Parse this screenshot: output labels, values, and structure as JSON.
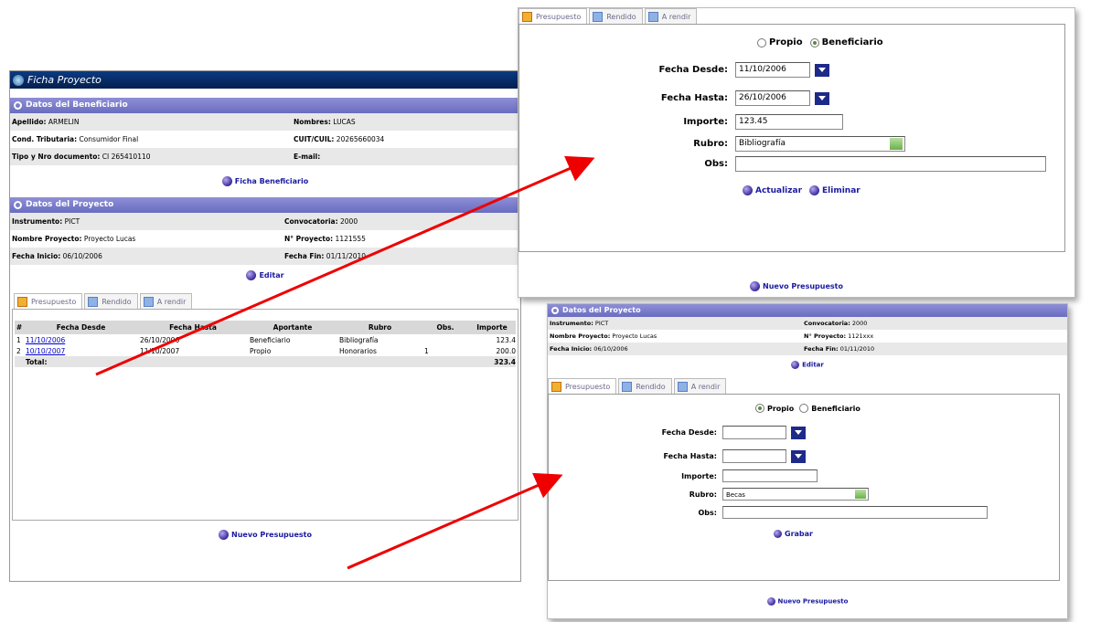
{
  "main": {
    "title": "Ficha Proyecto",
    "beneficiario": {
      "heading": "Datos del Beneficiario",
      "rows": [
        {
          "l_label": "Apellido:",
          "l_value": "ARMELIN",
          "r_label": "Nombres:",
          "r_value": "LUCAS"
        },
        {
          "l_label": "Cond. Tributaria:",
          "l_value": "Consumidor Final",
          "r_label": "CUIT/CUIL:",
          "r_value": "20265660034"
        },
        {
          "l_label": "Tipo y Nro documento:",
          "l_value": "CI 265410110",
          "r_label": "E-mail:",
          "r_value": ""
        }
      ],
      "link": "Ficha Beneficiario"
    },
    "proyecto": {
      "heading": "Datos del Proyecto",
      "rows": [
        {
          "l_label": "Instrumento:",
          "l_value": "PICT",
          "r_label": "Convocatoria:",
          "r_value": "2000"
        },
        {
          "l_label": "Nombre Proyecto:",
          "l_value": "Proyecto Lucas",
          "r_label": "N° Proyecto:",
          "r_value": "1121555"
        },
        {
          "l_label": "Fecha Inicio:",
          "l_value": "06/10/2006",
          "r_label": "Fecha Fin:",
          "r_value": "01/11/2010"
        }
      ],
      "link": "Editar"
    },
    "tabs": [
      "Presupuesto",
      "Rendido",
      "A rendir"
    ],
    "table": {
      "headers": [
        "#",
        "Fecha Desde",
        "Fecha Hasta",
        "Aportante",
        "Rubro",
        "Obs.",
        "Importe"
      ],
      "rows": [
        [
          "1",
          "11/10/2006",
          "26/10/2006",
          "Beneficiario",
          "Bibliografía",
          "",
          "123.4"
        ],
        [
          "2",
          "10/10/2007",
          "11/10/2007",
          "Propio",
          "Honorarios",
          "1",
          "200.0"
        ]
      ],
      "total_label": "Total:",
      "total_value": "323.4"
    },
    "footer_link": "Nuevo Presupuesto"
  },
  "top_form": {
    "tabs": [
      "Presupuesto",
      "Rendido",
      "A rendir"
    ],
    "radio_propio": "Propio",
    "radio_beneficiario": "Beneficiario",
    "fecha_desde_label": "Fecha Desde:",
    "fecha_desde_value": "11/10/2006",
    "fecha_hasta_label": "Fecha Hasta:",
    "fecha_hasta_value": "26/10/2006",
    "importe_label": "Importe:",
    "importe_value": "123.45",
    "rubro_label": "Rubro:",
    "rubro_value": "Bibliografía",
    "obs_label": "Obs:",
    "actualizar": "Actualizar",
    "eliminar": "Eliminar",
    "footer_link": "Nuevo Presupuesto"
  },
  "bottom_form": {
    "proyecto": {
      "heading": "Datos del Proyecto",
      "rows": [
        {
          "l_label": "Instrumento:",
          "l_value": "PICT",
          "r_label": "Convocatoria:",
          "r_value": "2000"
        },
        {
          "l_label": "Nombre Proyecto:",
          "l_value": "Proyecto Lucas",
          "r_label": "N° Proyecto:",
          "r_value": "1121xxx"
        },
        {
          "l_label": "Fecha Inicio:",
          "l_value": "06/10/2006",
          "r_label": "Fecha Fin:",
          "r_value": "01/11/2010"
        }
      ],
      "link": "Editar"
    },
    "tabs": [
      "Presupuesto",
      "Rendido",
      "A rendir"
    ],
    "radio_propio": "Propio",
    "radio_beneficiario": "Beneficiario",
    "fecha_desde_label": "Fecha Desde:",
    "fecha_hasta_label": "Fecha Hasta:",
    "importe_label": "Importe:",
    "rubro_label": "Rubro:",
    "rubro_value": "Becas",
    "obs_label": "Obs:",
    "grabar": "Grabar",
    "footer_link": "Nuevo Presupuesto"
  },
  "colors": {
    "header_bar": "#0a2a6a",
    "section_purple": "#7577c8",
    "arrow": "#ee0000",
    "link": "#1a1aa0"
  }
}
